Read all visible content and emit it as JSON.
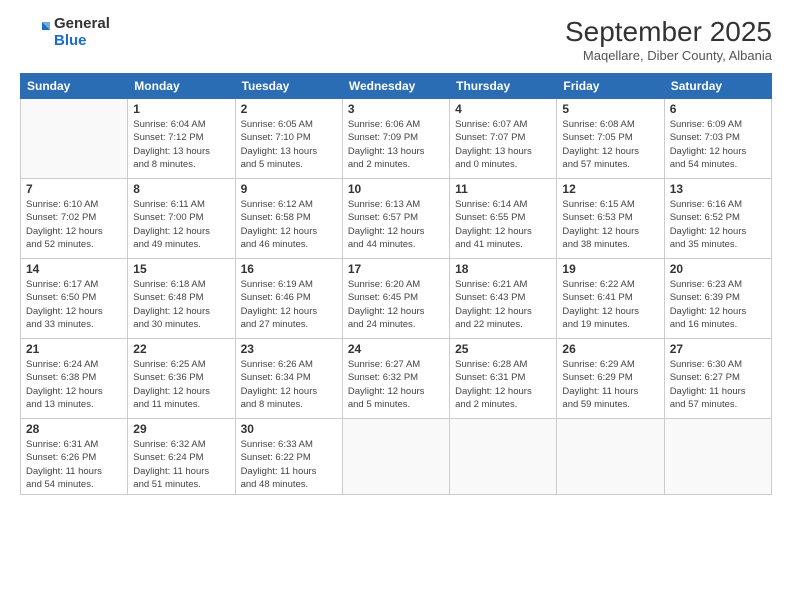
{
  "logo": {
    "general": "General",
    "blue": "Blue"
  },
  "header": {
    "month": "September 2025",
    "location": "Maqellare, Diber County, Albania"
  },
  "weekdays": [
    "Sunday",
    "Monday",
    "Tuesday",
    "Wednesday",
    "Thursday",
    "Friday",
    "Saturday"
  ],
  "weeks": [
    [
      {
        "day": "",
        "info": ""
      },
      {
        "day": "1",
        "info": "Sunrise: 6:04 AM\nSunset: 7:12 PM\nDaylight: 13 hours\nand 8 minutes."
      },
      {
        "day": "2",
        "info": "Sunrise: 6:05 AM\nSunset: 7:10 PM\nDaylight: 13 hours\nand 5 minutes."
      },
      {
        "day": "3",
        "info": "Sunrise: 6:06 AM\nSunset: 7:09 PM\nDaylight: 13 hours\nand 2 minutes."
      },
      {
        "day": "4",
        "info": "Sunrise: 6:07 AM\nSunset: 7:07 PM\nDaylight: 13 hours\nand 0 minutes."
      },
      {
        "day": "5",
        "info": "Sunrise: 6:08 AM\nSunset: 7:05 PM\nDaylight: 12 hours\nand 57 minutes."
      },
      {
        "day": "6",
        "info": "Sunrise: 6:09 AM\nSunset: 7:03 PM\nDaylight: 12 hours\nand 54 minutes."
      }
    ],
    [
      {
        "day": "7",
        "info": "Sunrise: 6:10 AM\nSunset: 7:02 PM\nDaylight: 12 hours\nand 52 minutes."
      },
      {
        "day": "8",
        "info": "Sunrise: 6:11 AM\nSunset: 7:00 PM\nDaylight: 12 hours\nand 49 minutes."
      },
      {
        "day": "9",
        "info": "Sunrise: 6:12 AM\nSunset: 6:58 PM\nDaylight: 12 hours\nand 46 minutes."
      },
      {
        "day": "10",
        "info": "Sunrise: 6:13 AM\nSunset: 6:57 PM\nDaylight: 12 hours\nand 44 minutes."
      },
      {
        "day": "11",
        "info": "Sunrise: 6:14 AM\nSunset: 6:55 PM\nDaylight: 12 hours\nand 41 minutes."
      },
      {
        "day": "12",
        "info": "Sunrise: 6:15 AM\nSunset: 6:53 PM\nDaylight: 12 hours\nand 38 minutes."
      },
      {
        "day": "13",
        "info": "Sunrise: 6:16 AM\nSunset: 6:52 PM\nDaylight: 12 hours\nand 35 minutes."
      }
    ],
    [
      {
        "day": "14",
        "info": "Sunrise: 6:17 AM\nSunset: 6:50 PM\nDaylight: 12 hours\nand 33 minutes."
      },
      {
        "day": "15",
        "info": "Sunrise: 6:18 AM\nSunset: 6:48 PM\nDaylight: 12 hours\nand 30 minutes."
      },
      {
        "day": "16",
        "info": "Sunrise: 6:19 AM\nSunset: 6:46 PM\nDaylight: 12 hours\nand 27 minutes."
      },
      {
        "day": "17",
        "info": "Sunrise: 6:20 AM\nSunset: 6:45 PM\nDaylight: 12 hours\nand 24 minutes."
      },
      {
        "day": "18",
        "info": "Sunrise: 6:21 AM\nSunset: 6:43 PM\nDaylight: 12 hours\nand 22 minutes."
      },
      {
        "day": "19",
        "info": "Sunrise: 6:22 AM\nSunset: 6:41 PM\nDaylight: 12 hours\nand 19 minutes."
      },
      {
        "day": "20",
        "info": "Sunrise: 6:23 AM\nSunset: 6:39 PM\nDaylight: 12 hours\nand 16 minutes."
      }
    ],
    [
      {
        "day": "21",
        "info": "Sunrise: 6:24 AM\nSunset: 6:38 PM\nDaylight: 12 hours\nand 13 minutes."
      },
      {
        "day": "22",
        "info": "Sunrise: 6:25 AM\nSunset: 6:36 PM\nDaylight: 12 hours\nand 11 minutes."
      },
      {
        "day": "23",
        "info": "Sunrise: 6:26 AM\nSunset: 6:34 PM\nDaylight: 12 hours\nand 8 minutes."
      },
      {
        "day": "24",
        "info": "Sunrise: 6:27 AM\nSunset: 6:32 PM\nDaylight: 12 hours\nand 5 minutes."
      },
      {
        "day": "25",
        "info": "Sunrise: 6:28 AM\nSunset: 6:31 PM\nDaylight: 12 hours\nand 2 minutes."
      },
      {
        "day": "26",
        "info": "Sunrise: 6:29 AM\nSunset: 6:29 PM\nDaylight: 11 hours\nand 59 minutes."
      },
      {
        "day": "27",
        "info": "Sunrise: 6:30 AM\nSunset: 6:27 PM\nDaylight: 11 hours\nand 57 minutes."
      }
    ],
    [
      {
        "day": "28",
        "info": "Sunrise: 6:31 AM\nSunset: 6:26 PM\nDaylight: 11 hours\nand 54 minutes."
      },
      {
        "day": "29",
        "info": "Sunrise: 6:32 AM\nSunset: 6:24 PM\nDaylight: 11 hours\nand 51 minutes."
      },
      {
        "day": "30",
        "info": "Sunrise: 6:33 AM\nSunset: 6:22 PM\nDaylight: 11 hours\nand 48 minutes."
      },
      {
        "day": "",
        "info": ""
      },
      {
        "day": "",
        "info": ""
      },
      {
        "day": "",
        "info": ""
      },
      {
        "day": "",
        "info": ""
      }
    ]
  ]
}
